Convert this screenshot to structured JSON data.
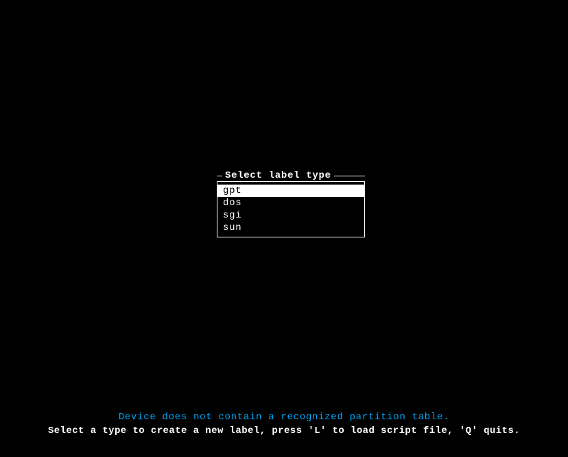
{
  "dialog": {
    "title": "Select label type",
    "items": [
      {
        "label": "gpt",
        "selected": true
      },
      {
        "label": "dos",
        "selected": false
      },
      {
        "label": "sgi",
        "selected": false
      },
      {
        "label": "sun",
        "selected": false
      }
    ]
  },
  "status": {
    "line1": "Device does not contain a recognized partition table.",
    "line2": "Select a type to create a new label, press 'L' to load script file, 'Q' quits."
  }
}
